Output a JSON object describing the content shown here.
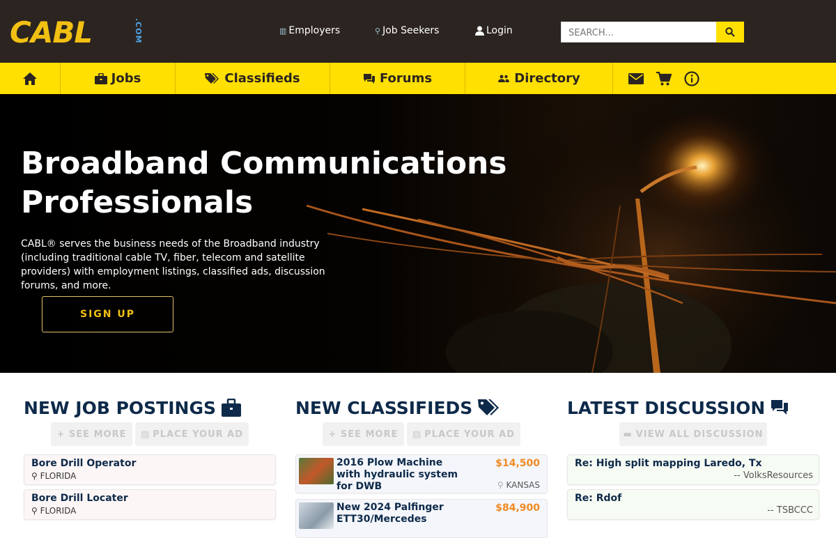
{
  "header": {
    "logo_text": "CABL",
    "logo_com": ".COM",
    "links": [
      {
        "label": "Employers",
        "icon": "building-icon"
      },
      {
        "label": "Job Seekers",
        "icon": "person-icon"
      },
      {
        "label": "Login",
        "icon": "user-icon"
      }
    ],
    "search_placeholder": "SEARCH..."
  },
  "nav": {
    "items": [
      {
        "label": "",
        "icon": "home-icon"
      },
      {
        "label": "Jobs",
        "icon": "briefcase-icon"
      },
      {
        "label": "Classifieds",
        "icon": "tags-icon"
      },
      {
        "label": "Forums",
        "icon": "chat-icon"
      },
      {
        "label": "Directory",
        "icon": "people-icon"
      }
    ],
    "right_icons": [
      "mail-icon",
      "cart-icon",
      "info-icon"
    ]
  },
  "hero": {
    "title_line1": "Broadband Communications",
    "title_line2": "Professionals",
    "description": "CABL® serves the business needs of the Broadband industry (including traditional cable TV, fiber, telecom and satellite providers) with employment listings, classified ads, discussion forums, and more.",
    "signup_label": "SIGN UP"
  },
  "jobs": {
    "title": "NEW JOB POSTINGS",
    "see_more": "+ SEE MORE",
    "place_ad": "PLACE YOUR AD",
    "items": [
      {
        "title": "Bore Drill Operator",
        "location": "FLORIDA"
      },
      {
        "title": "Bore Drill Locater",
        "location": "FLORIDA"
      }
    ]
  },
  "classifieds": {
    "title": "NEW CLASSIFIEDS",
    "see_more": "+ SEE MORE",
    "place_ad": "PLACE YOUR AD",
    "items": [
      {
        "title": "2016 Plow Machine with hydraulic system for DWB",
        "price": "$14,500",
        "location": "KANSAS"
      },
      {
        "title": "New 2024 Palfinger ETT30/Mercedes",
        "price": "$84,900",
        "location": ""
      }
    ]
  },
  "discussion": {
    "title": "LATEST DISCUSSION",
    "view_all": "VIEW ALL DISCUSSION",
    "items": [
      {
        "title": "Re: High split mapping Laredo, Tx",
        "author": "-- VolksResources"
      },
      {
        "title": "Re: Rdof",
        "author": "-- TSBCCC"
      }
    ]
  },
  "colors": {
    "topbar": "#2b2420",
    "accent_yellow": "#ffe000",
    "navy": "#0e2a4a",
    "price_orange": "#f08a24"
  }
}
